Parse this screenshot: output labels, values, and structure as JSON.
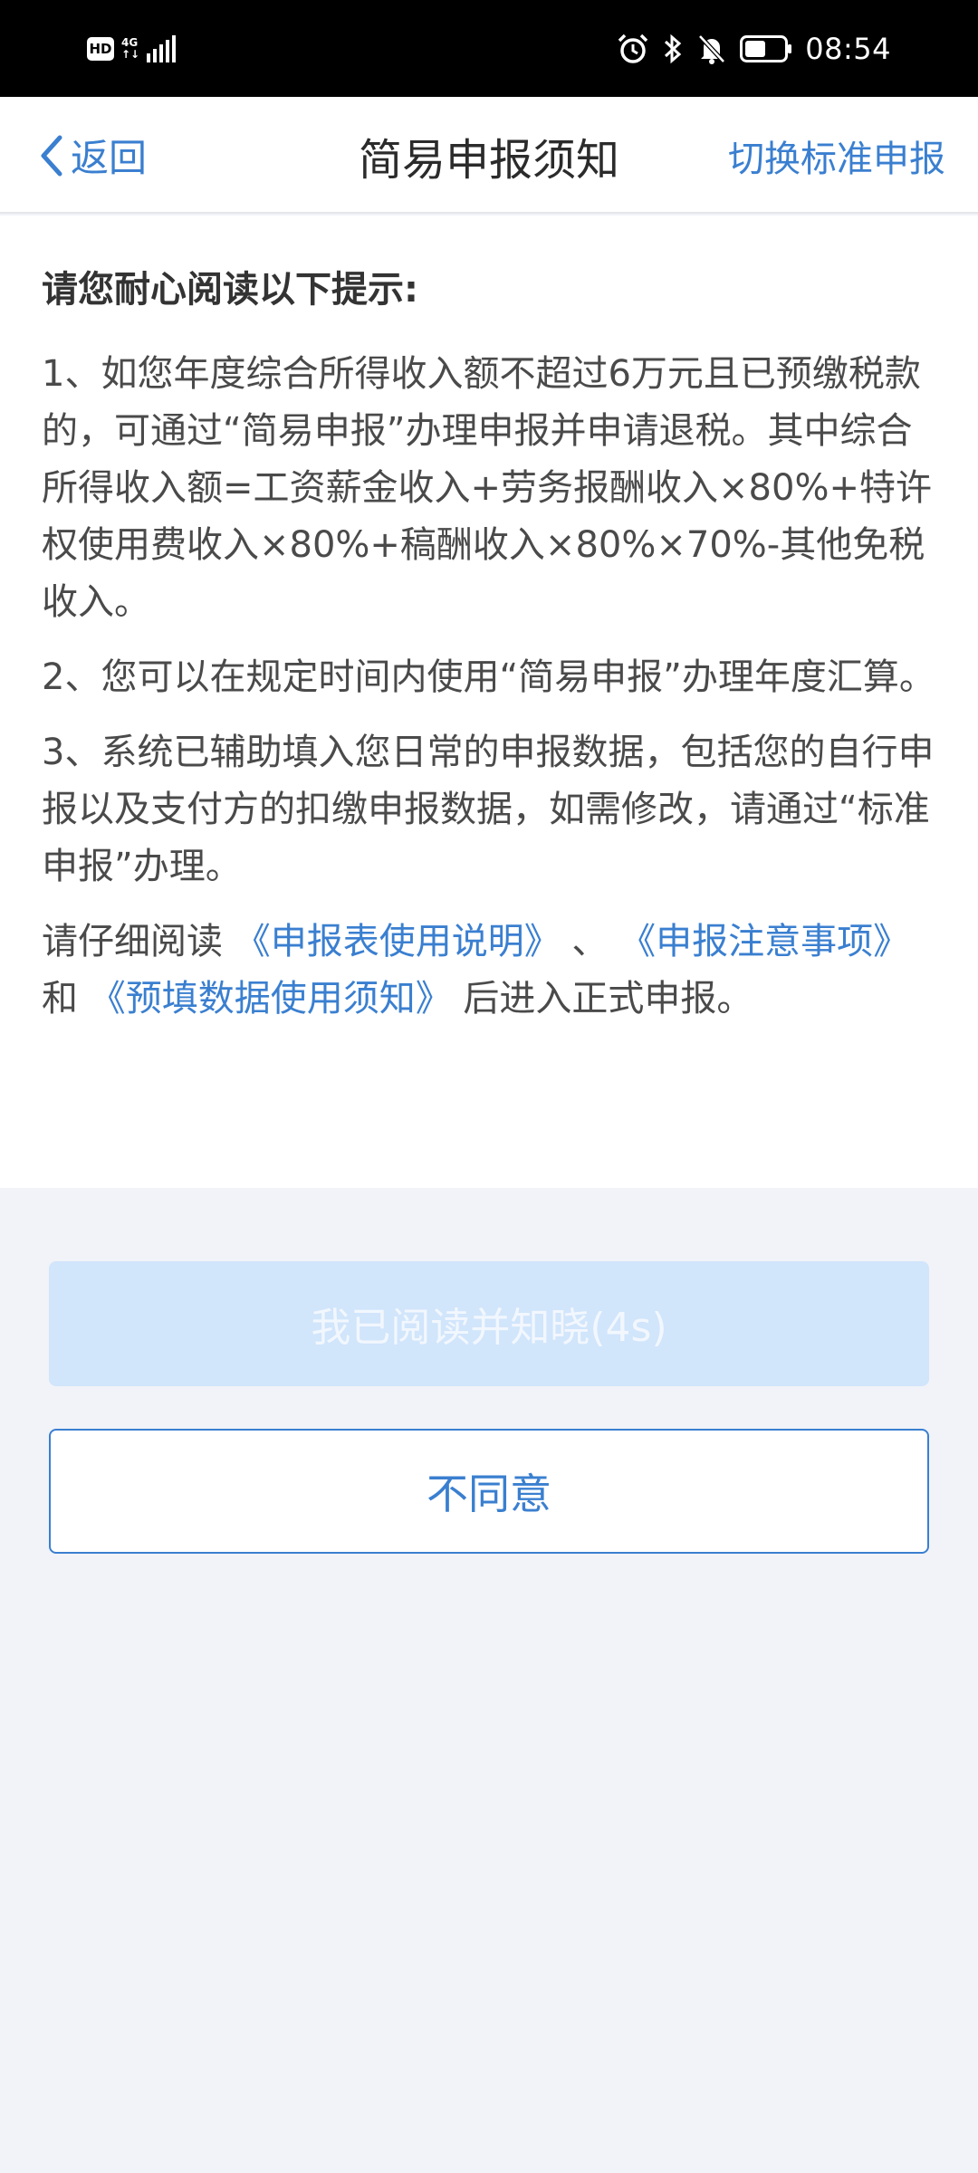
{
  "status_bar": {
    "hd": "HD",
    "network_top": "4G",
    "network_bottom": "↑↓",
    "time": "08:54"
  },
  "nav": {
    "back_label": "返回",
    "title": "简易申报须知",
    "switch_label": "切换标准申报"
  },
  "notice": {
    "heading": "请您耐心阅读以下提示:",
    "para1": "1、如您年度综合所得收入额不超过6万元且已预缴税款的，可通过“简易申报”办理申报并申请退税。其中综合所得收入额=工资薪金收入+劳务报酬收入×80%+特许权使用费收入×80%+稿酬收入×80%×70%-其他免税收入。",
    "para2": "2、您可以在规定时间内使用“简易申报”办理年度汇算。",
    "para3": "3、系统已辅助填入您日常的申报数据，包括您的自行申报以及支付方的扣缴申报数据，如需修改，请通过“标准申报”办理。",
    "final_prefix": "请仔细阅读 ",
    "link1": "《申报表使用说明》",
    "sep1": " 、 ",
    "link2": "《申报注意事项》",
    "sep2": "和 ",
    "link3": "《预填数据使用须知》",
    "final_suffix": " 后进入正式申报。"
  },
  "buttons": {
    "agree_label": "我已阅读并知晓(4s)",
    "disagree_label": "不同意"
  }
}
